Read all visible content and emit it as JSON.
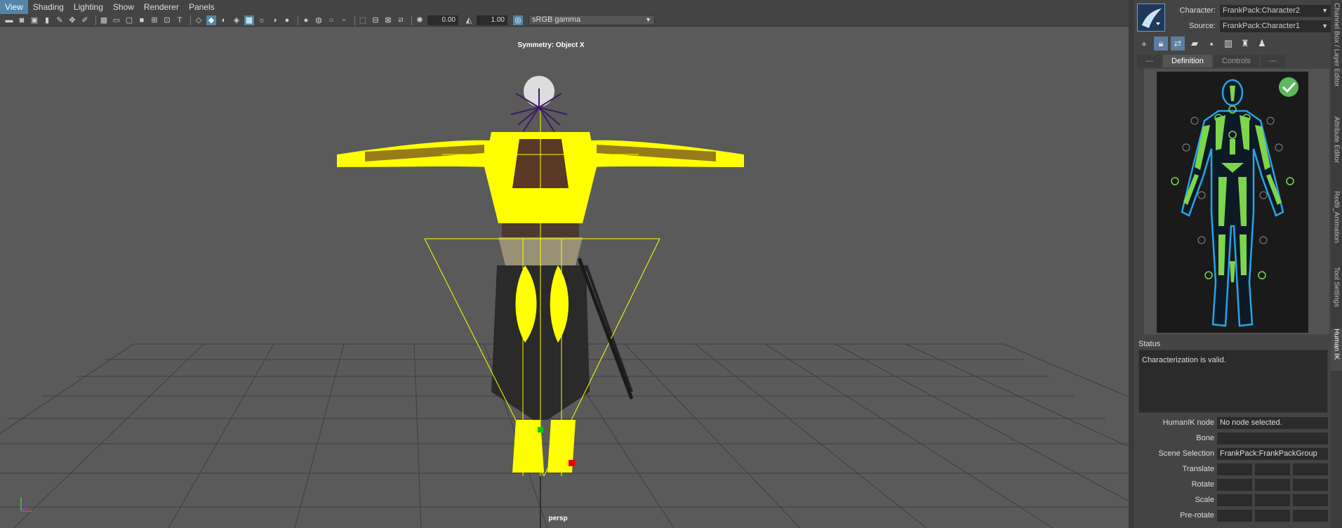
{
  "menu": [
    "View",
    "Shading",
    "Lighting",
    "Show",
    "Renderer",
    "Panels"
  ],
  "toolbar": {
    "exposure": "0.00",
    "gamma": "1.00",
    "color_space": "sRGB gamma"
  },
  "viewport": {
    "symmetry_label": "Symmetry: Object X",
    "camera_label": "persp"
  },
  "hik": {
    "character_label": "Character:",
    "character_value": "FrankPack:Character2",
    "source_label": "Source:",
    "source_value": "FrankPack:Character1",
    "tabs": [
      "---",
      "Definition",
      "Controls",
      "---"
    ],
    "status_heading": "Status",
    "status_text": "Characterization is valid.",
    "props": {
      "node_label": "HumanIK node",
      "node_value": "No node selected.",
      "bone_label": "Bone",
      "bone_value": "",
      "scene_label": "Scene Selection",
      "scene_value": "FrankPack:FrankPackGroup",
      "translate_label": "Translate",
      "rotate_label": "Rotate",
      "scale_label": "Scale",
      "prerotate_label": "Pre-rotate"
    }
  },
  "side_tabs": [
    "Channel Box / Layer Editor",
    "Attribute Editor",
    "Red9_Animation",
    "Tool Settings",
    "Human IK"
  ],
  "colors": {
    "accent": "#5285a6",
    "highlight": "#ffff00",
    "figure_limb": "#7cd64b",
    "figure_outline": "#2aa3e8",
    "valid_check": "#5cb85c"
  }
}
